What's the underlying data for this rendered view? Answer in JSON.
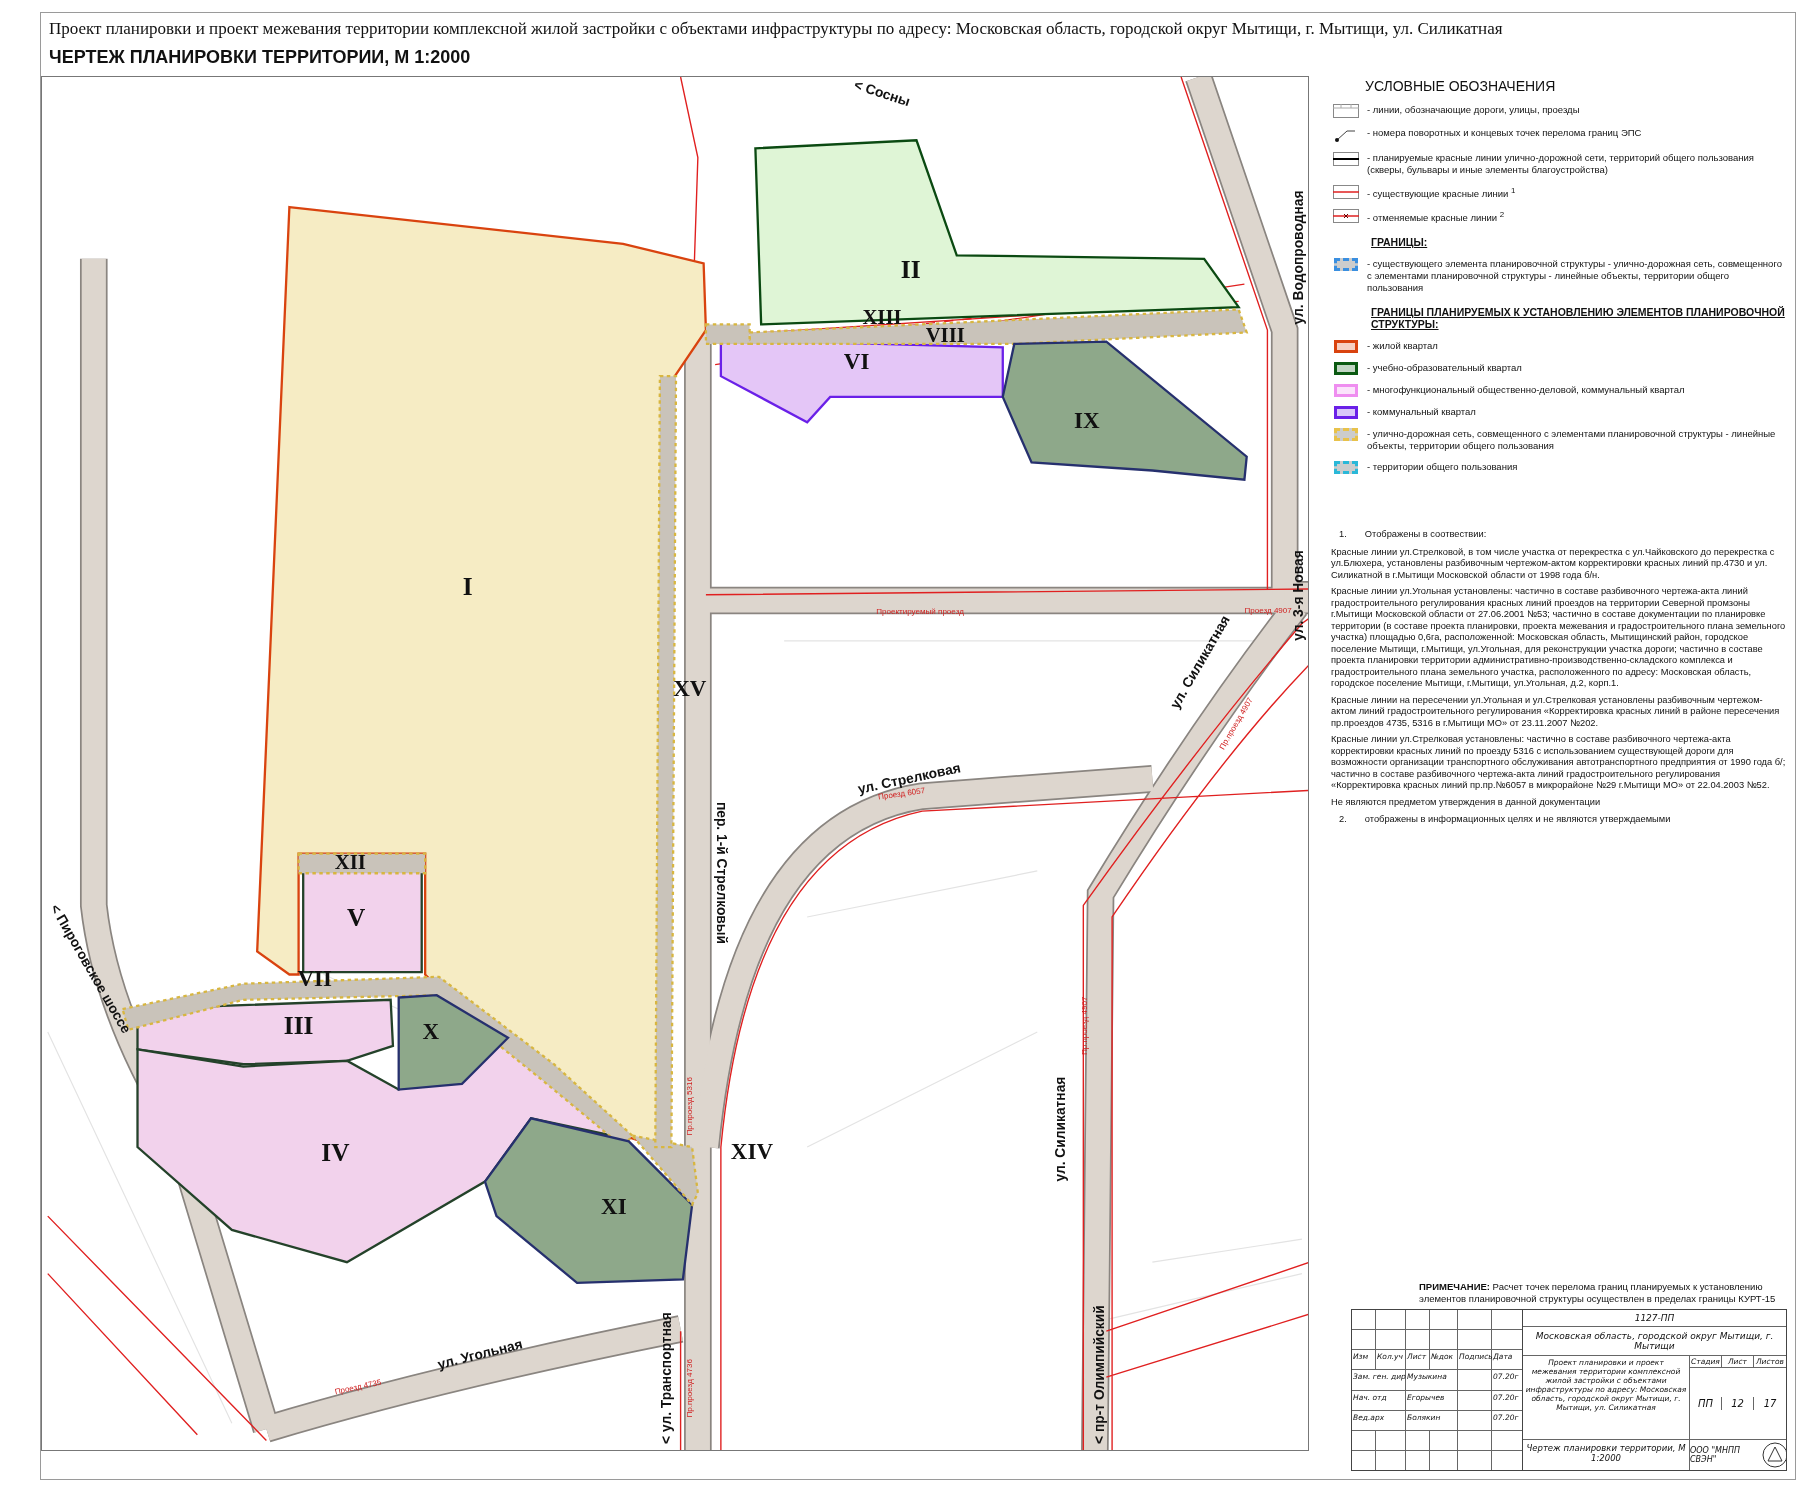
{
  "header": {
    "title": "Проект планировки и проект межевания территории комплексной жилой застройки с объектами инфраструктуры по адресу: Московская область, городской округ Мытищи, г. Мытищи, ул. Силикатная",
    "subtitle": "ЧЕРТЕЖ ПЛАНИРОВКИ ТЕРРИТОРИИ, М 1:2000"
  },
  "map": {
    "quarters": [
      {
        "label": "I",
        "kind": "residential"
      },
      {
        "label": "II",
        "kind": "educational"
      },
      {
        "label": "III",
        "kind": "mixed"
      },
      {
        "label": "IV",
        "kind": "mixed"
      },
      {
        "label": "V",
        "kind": "mixed"
      },
      {
        "label": "VI",
        "kind": "communal"
      },
      {
        "label": "VII",
        "kind": "road"
      },
      {
        "label": "VIII",
        "kind": "road"
      },
      {
        "label": "IX",
        "kind": "public"
      },
      {
        "label": "X",
        "kind": "public"
      },
      {
        "label": "XI",
        "kind": "public"
      },
      {
        "label": "XII",
        "kind": "road"
      },
      {
        "label": "XIII",
        "kind": "road"
      },
      {
        "label": "XIV",
        "kind": "road"
      },
      {
        "label": "XV",
        "kind": "road"
      }
    ],
    "streets": [
      {
        "label": "< Сосны",
        "kind": "street"
      },
      {
        "label": "ул. Водопроводная",
        "kind": "street"
      },
      {
        "label": "ул. 3-я Новая",
        "kind": "street"
      },
      {
        "label": "пер. 1-й Стрелковый",
        "kind": "street"
      },
      {
        "label": "ул. Стрелковая",
        "kind": "street"
      },
      {
        "label": "ул. Силикатная",
        "kind": "street"
      },
      {
        "label": "ул. Силикатная",
        "kind": "street"
      },
      {
        "label": "< Пироговское шоссе",
        "kind": "street"
      },
      {
        "label": "ул. Угольная",
        "kind": "street"
      },
      {
        "label": "< ул. Транспортная",
        "kind": "street"
      },
      {
        "label": "< пр-т Олимпийский",
        "kind": "street"
      },
      {
        "label": "Проектируемый проезд",
        "kind": "passage"
      },
      {
        "label": "Проезд 4907",
        "kind": "passage"
      },
      {
        "label": "Пр.проезд 4907",
        "kind": "passage"
      },
      {
        "label": "Проезд 6057",
        "kind": "passage"
      },
      {
        "label": "Проезд 4735",
        "kind": "passage"
      },
      {
        "label": "Пр.проезд 4736",
        "kind": "passage"
      },
      {
        "label": "Пр.проезд 5316",
        "kind": "passage"
      },
      {
        "label": "Пр.проезд 4907",
        "kind": "passage"
      }
    ]
  },
  "legend": {
    "title": "УСЛОВНЫЕ ОБОЗНАЧЕНИЯ",
    "groups": [
      {
        "items": [
          {
            "kind": "road",
            "text": "- линии, обозначающие дороги, улицы, проезды"
          },
          {
            "kind": "point",
            "text": "- номера поворотных и концевых точек перелома границ ЭПС"
          },
          {
            "kind": "planned",
            "text": "- планируемые красные линии улично-дорожной сети, территорий общего пользования (скверы, бульвары и иные элементы благоустройства)"
          },
          {
            "kind": "existing",
            "text": "- существующие красные линии $^{1}$"
          },
          {
            "kind": "cancelled",
            "text": "- отменяемые красные линии $^{2}$"
          }
        ]
      },
      {
        "heading": "ГРАНИЦЫ:",
        "items": [
          {
            "kind": "dashed",
            "color": "#3a8fe0",
            "text": "- существующего элемента планировочной структуры - улично-дорожная сеть, совмещенного с элементами планировочной структуры - линейные объекты, территории общего пользования"
          }
        ]
      },
      {
        "heading": "ГРАНИЦЫ ПЛАНИРУЕМЫХ К УСТАНОВЛЕНИЮ ЭЛЕМЕНТОВ ПЛАНИРОВОЧНОЙ СТРУКТУРЫ:",
        "items": [
          {
            "kind": "quarter",
            "color": "#d9430f",
            "text": "- жилой квартал"
          },
          {
            "kind": "quarter",
            "color": "#0b5a12",
            "text": "- учебно-образовательный квартал"
          },
          {
            "kind": "quarter",
            "color": "#ef8ef0",
            "text": "- многофункциональный общественно-деловой, коммунальный квартал"
          },
          {
            "kind": "quarter",
            "color": "#6a20e8",
            "text": "- коммунальный квартал"
          },
          {
            "kind": "dashed",
            "color": "#e8c24a",
            "text": "- улично-дорожная сеть, совмещенного с элементами планировочной структуры - линейные объекты, территории общего пользования"
          },
          {
            "kind": "dashed",
            "color": "#2ab8d8",
            "text": "- территории общего пользования"
          }
        ]
      }
    ]
  },
  "notes": [
    {
      "kind": "numbered",
      "number": "1.",
      "text": "Отображены в соотвествии:"
    },
    {
      "kind": "para",
      "text": "Красные линии ул.Стрелковой, в том числе участка от перекрестка с ул.Чайковского до перекрестка с ул.Блюхера, установлены разбивочным чертежом-актом корректировки красных линий пр.4730 и ул. Силикатной в г.Мытищи Московской области от 1998 года б/н."
    },
    {
      "kind": "para",
      "text": "Красные линии ул.Угольная установлены: частично в составе разбивочного чертежа-акта линий градостроительного регулирования красных линий проездов на территории Северной промзоны г.Мытищи Московской области от 27.06.2001 №53; частично в составе документации по планировке территории (в составе проекта планировки, проекта межевания и градостроительного плана земельного участка) площадью 0,6га, расположенной: Московская область, Мытищинский район, городское поселение Мытищи, г.Мытищи, ул.Угольная, для реконструкции участка дороги; частично в составе проекта планировки территории административно-производственно-складского комплекса и градостроительного плана земельного участка, расположенного по адресу: Московская область, городское поселение Мытищи, г.Мытищи, ул.Угольная, д.2, корп.1."
    },
    {
      "kind": "para",
      "text": "Красные линии на пересечении ул.Угольная и ул.Стрелковая установлены разбивочным чертежом-актом линий градостроительного регулирования «Корректировка красных линий в районе пересечения пр.проездов 4735, 5316 в г.Мытищи МО» от 23.11.2007 №202."
    },
    {
      "kind": "para",
      "text": "Красные линии ул.Стрелковая установлены: частично в составе разбивочного чертежа-акта корректировки красных линий по проезду 5316 с использованием существующей дороги для возможности организации транспортного обслуживания автотранспортного предприятия от 1990 года б/; частично в составе разбивочного чертежа-акта линий градостроительного регулирования «Корректировка красных линий пр.пр.№6057 в микрорайоне №29 г.Мытищи МО» от 22.04.2003 №52."
    },
    {
      "kind": "para",
      "text": "Не являются предметом утверждения в данной документации"
    },
    {
      "kind": "numbered",
      "number": "2.",
      "text": "отображены в информационных целях и не являются утверждаемыми"
    }
  ],
  "remark": "**ПРИМЕЧАНИЕ:** Расчет точек перелома границ планируемых к установлению элементов планировочной структуры осуществлен в пределах границы КУРТ-15",
  "stamp": {
    "code": "1127-ПП",
    "place": "Московская область, городской округ Мытищи, г. Мытищи",
    "columns": [
      "Изм",
      "Кол.уч",
      "Лист",
      "№док",
      "Подпись",
      "Дата"
    ],
    "signers": [
      {
        "role": "Зам. ген. дир",
        "name": "Музыкина",
        "date": "07.20г"
      },
      {
        "role": "Нач. отд",
        "name": "Егорычев",
        "date": "07.20г"
      },
      {
        "role": "Вед.арх",
        "name": "Болякин",
        "date": "07.20г"
      }
    ],
    "project": "Проект планировки и проект межевания территории комплексной жилой застройки с объектами инфраструктуры по адресу: Московская область, городской округ Мытищи, г. Мытищи, ул. Силикатная",
    "stage_heads": [
      "Стадия",
      "Лист",
      "Листов"
    ],
    "stage_values": [
      "ПП",
      "12",
      "17"
    ],
    "sheet": "Чертеж планировки территории, М 1:2000",
    "company": "ООО \"МНПП СВЭН\""
  }
}
